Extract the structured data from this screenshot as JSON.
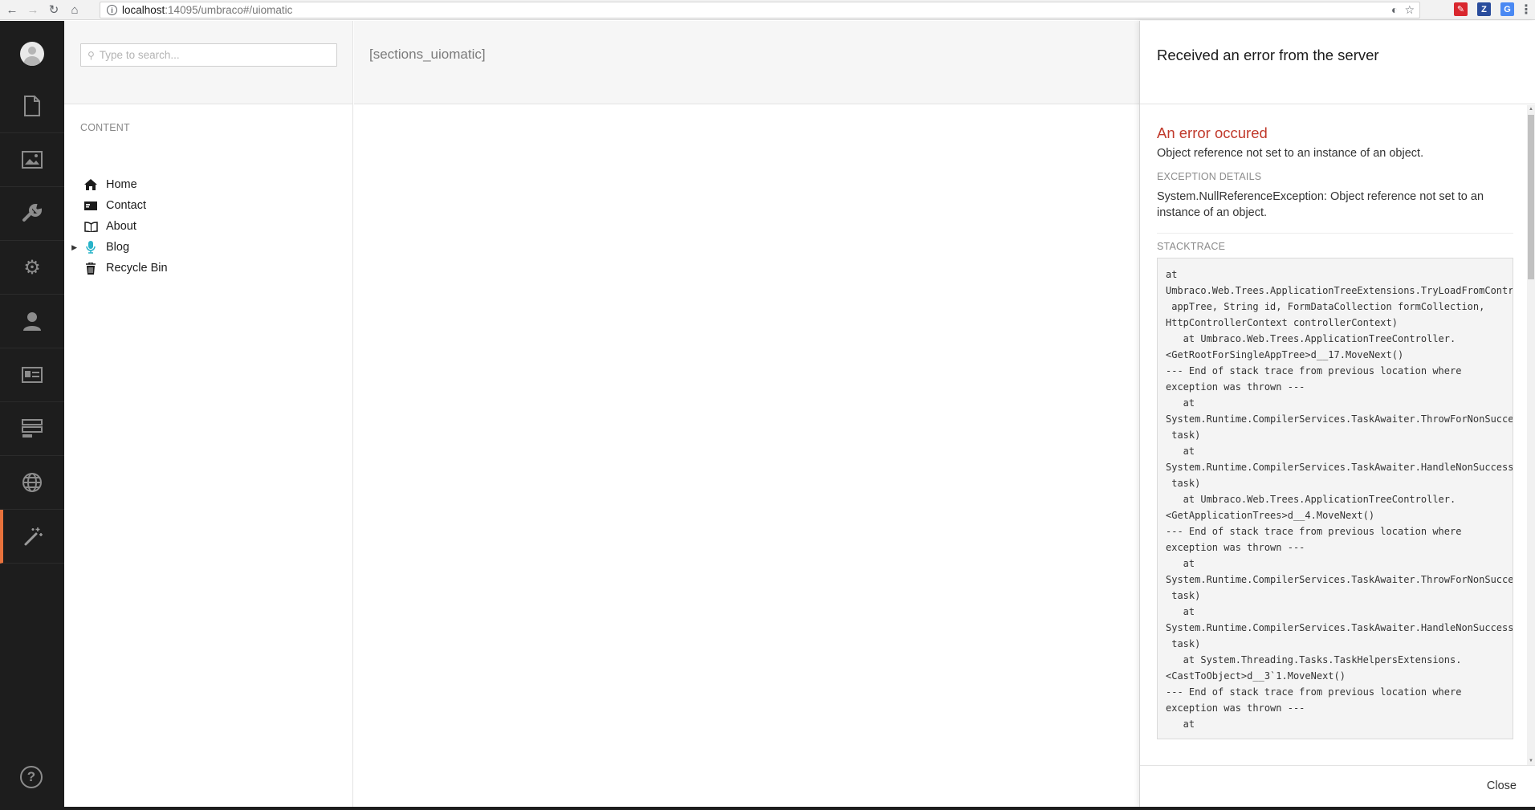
{
  "browser": {
    "url_host": "localhost",
    "url_path": ":14095/umbraco#/uiomatic",
    "back_icon": "arrow-left-icon",
    "forward_icon": "arrow-right-icon",
    "reload_icon": "reload-icon",
    "home_icon": "home-icon"
  },
  "sidebar": {
    "sections": [
      {
        "name": "content",
        "icon": "document-icon"
      },
      {
        "name": "media",
        "icon": "picture-icon"
      },
      {
        "name": "settings",
        "icon": "wrench-icon"
      },
      {
        "name": "developer",
        "icon": "gear-icon"
      },
      {
        "name": "users",
        "icon": "user-icon"
      },
      {
        "name": "members",
        "icon": "id-card-icon"
      },
      {
        "name": "forms",
        "icon": "forms-icon"
      },
      {
        "name": "translation",
        "icon": "globe-icon"
      },
      {
        "name": "uiomatic",
        "icon": "magic-wand-icon",
        "active": true
      }
    ],
    "help_icon": "help-icon",
    "accent": "#e8723c"
  },
  "tree": {
    "search_placeholder": "Type to search...",
    "root_label": "CONTENT",
    "items": [
      {
        "label": "Home",
        "icon": "home-icon",
        "has_children": false
      },
      {
        "label": "Contact",
        "icon": "id-card-icon",
        "has_children": false
      },
      {
        "label": "About",
        "icon": "book-icon",
        "has_children": false
      },
      {
        "label": "Blog",
        "icon": "microphone-icon",
        "has_children": true
      },
      {
        "label": "Recycle Bin",
        "icon": "trash-icon",
        "has_children": false
      }
    ]
  },
  "main": {
    "title": "[sections_uiomatic]"
  },
  "error_panel": {
    "header_title": "Received an error from the server",
    "error_title": "An error occured",
    "error_message": "Object reference not set to an instance of an object.",
    "exception_label": "EXCEPTION DETAILS",
    "exception_text": "System.NullReferenceException: Object reference not set to an instance of an object.",
    "stacktrace_label": "STACKTRACE",
    "stacktrace": "at\nUmbraco.Web.Trees.ApplicationTreeExtensions.TryLoadFromControllerTree(ApplicationTree\n appTree, String id, FormDataCollection formCollection,\nHttpControllerContext controllerContext)\n   at Umbraco.Web.Trees.ApplicationTreeController.\n<GetRootForSingleAppTree>d__17.MoveNext()\n--- End of stack trace from previous location where\nexception was thrown ---\n   at\nSystem.Runtime.CompilerServices.TaskAwaiter.ThrowForNonSuccess(Task\n task)\n   at\nSystem.Runtime.CompilerServices.TaskAwaiter.HandleNonSuccessAndDebuggerNotification(Task\n task)\n   at Umbraco.Web.Trees.ApplicationTreeController.\n<GetApplicationTrees>d__4.MoveNext()\n--- End of stack trace from previous location where\nexception was thrown ---\n   at\nSystem.Runtime.CompilerServices.TaskAwaiter.ThrowForNonSuccess(Task\n task)\n   at\nSystem.Runtime.CompilerServices.TaskAwaiter.HandleNonSuccessAndDebuggerNotification(Task\n task)\n   at System.Threading.Tasks.TaskHelpersExtensions.\n<CastToObject>d__3`1.MoveNext()\n--- End of stack trace from previous location where\nexception was thrown ---\n   at",
    "close_label": "Close",
    "error_color": "#c0392b"
  }
}
